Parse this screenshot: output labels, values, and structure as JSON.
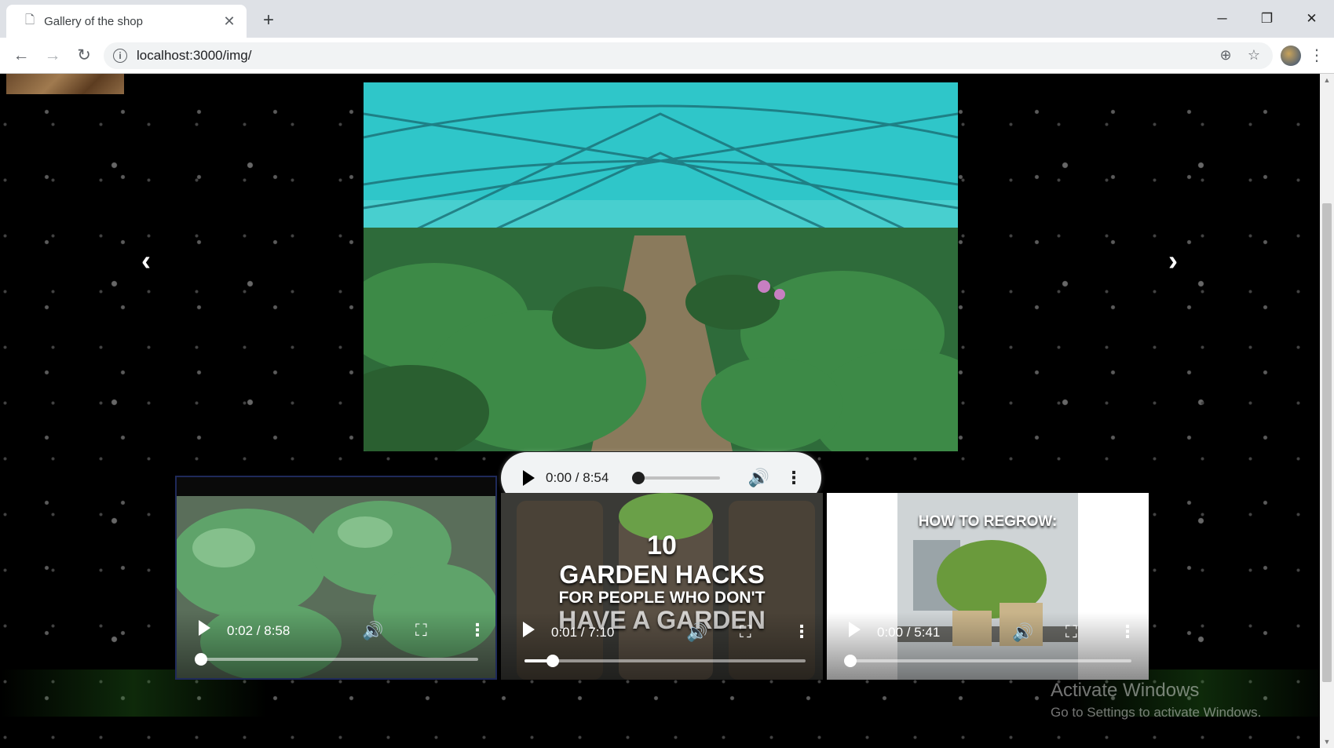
{
  "browser": {
    "tab_title": "Gallery of the shop",
    "tab_close": "✕",
    "new_tab": "+",
    "url": "localhost:3000/img/",
    "window": {
      "minimize": "─",
      "restore": "❐",
      "close": "✕"
    }
  },
  "gallery": {
    "prev_arrow": "‹",
    "next_arrow": "›",
    "audio": {
      "time": "0:00 / 8:54",
      "progress": 0.0
    }
  },
  "videos": [
    {
      "time": "0:02 / 8:58",
      "progress": 0.004,
      "title": ""
    },
    {
      "time": "0:01 / 7:10",
      "progress": 0.1,
      "title_number": "10",
      "title_main": "GARDEN HACKS",
      "title_sub": "FOR PEOPLE WHO DON'T",
      "title_end": "HAVE A GARDEN"
    },
    {
      "time": "0:00 / 5:41",
      "progress": 0.0,
      "title": "HOW TO REGROW:"
    }
  ],
  "watermark": {
    "line1": "Activate Windows",
    "line2": "Go to Settings to activate Windows."
  },
  "colors": {
    "accent": "#1f2a5a",
    "sky_net": "#2fc6c9",
    "foliage": "#2e6b3a"
  }
}
